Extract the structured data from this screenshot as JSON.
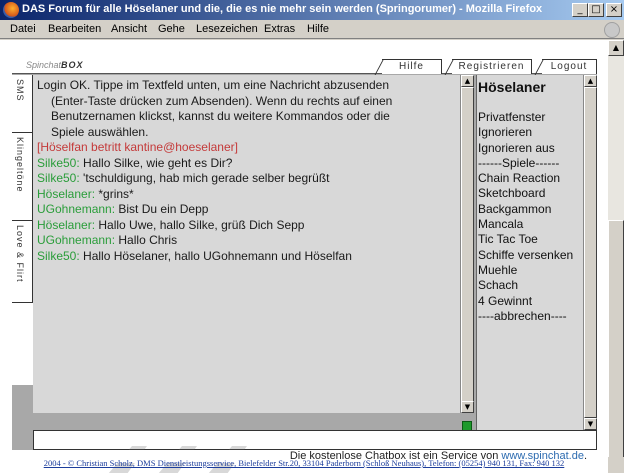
{
  "window": {
    "title": "DAS Forum für alle Höselaner und die, die es nie mehr sein werden (Springorumer) - Mozilla Firefox",
    "minimize": "_",
    "maximize": "□",
    "close": "×"
  },
  "menu": {
    "items": [
      "Datei",
      "Bearbeiten",
      "Ansicht",
      "Gehe",
      "Lesezeichen",
      "Extras",
      "Hilfe"
    ]
  },
  "chatbox": {
    "logo_prefix": "Spinchat",
    "logo_suffix": "BOX",
    "top_tabs": [
      "Hilfe",
      "Registrieren",
      "Logout"
    ],
    "side_tabs": [
      "SMS",
      "Klingeltöne",
      "Love & Flirt"
    ],
    "messages": [
      {
        "user": "",
        "text": "Login OK. Tippe im Textfeld unten, um eine Nachricht abzusenden",
        "type": "system"
      },
      {
        "user": "",
        "text": "(Enter-Taste drücken zum Absenden). Wenn du rechts auf einen",
        "type": "system-indent"
      },
      {
        "user": "",
        "text": "Benutzernamen klickst, kannst du weitere Kommandos oder die",
        "type": "system-indent"
      },
      {
        "user": "",
        "text": "Spiele auswählen.",
        "type": "system-indent"
      },
      {
        "user": "",
        "text": "[Höselfan betritt kantine@hoeselaner]",
        "type": "join"
      },
      {
        "user": "Silke50:",
        "text": "Hallo Silke, wie geht es Dir?",
        "type": "msg"
      },
      {
        "user": "Silke50:",
        "text": "'tschuldigung, hab mich gerade selber begrüßt",
        "type": "msg"
      },
      {
        "user": "Höselaner:",
        "text": "*grins*",
        "type": "msg"
      },
      {
        "user": "UGohnemann:",
        "text": "Bist Du ein Depp",
        "type": "msg"
      },
      {
        "user": "Höselaner:",
        "text": "Hallo Uwe, hallo Silke, grüß Dich Sepp",
        "type": "msg"
      },
      {
        "user": "UGohnemann:",
        "text": "Hallo Chris",
        "type": "msg"
      },
      {
        "user": "Silke50:",
        "text": "Hallo Höselaner, hallo UGohnemann und Höselfan",
        "type": "msg"
      }
    ],
    "user_panel": {
      "header": "Höselaner",
      "items": [
        "Privatfenster",
        "Ignorieren",
        "Ignorieren aus",
        "------Spiele------",
        "Chain Reaction",
        "Sketchboard",
        "Backgammon",
        "Mancala",
        "Tic Tac Toe",
        "Schiffe versenken",
        "Muehle",
        "Schach",
        "4 Gewinnt",
        "----abbrechen----"
      ]
    },
    "input_value": "",
    "service_text": "Die kostenlose Chatbox ist ein Service von",
    "service_link": "www.spinchat.de",
    "service_suffix": "."
  },
  "credits": "2004 - © Christian Scholz, DMS Dienstleistungsservice, Bielefelder Str.20, 33104 Paderborn (Schloß Neuhaus), Telefon: (05254) 940 131, Fax: 940 132",
  "colors": {
    "username": "#2a9d3a",
    "join": "#c43a3a",
    "link": "#2c6bb0"
  }
}
